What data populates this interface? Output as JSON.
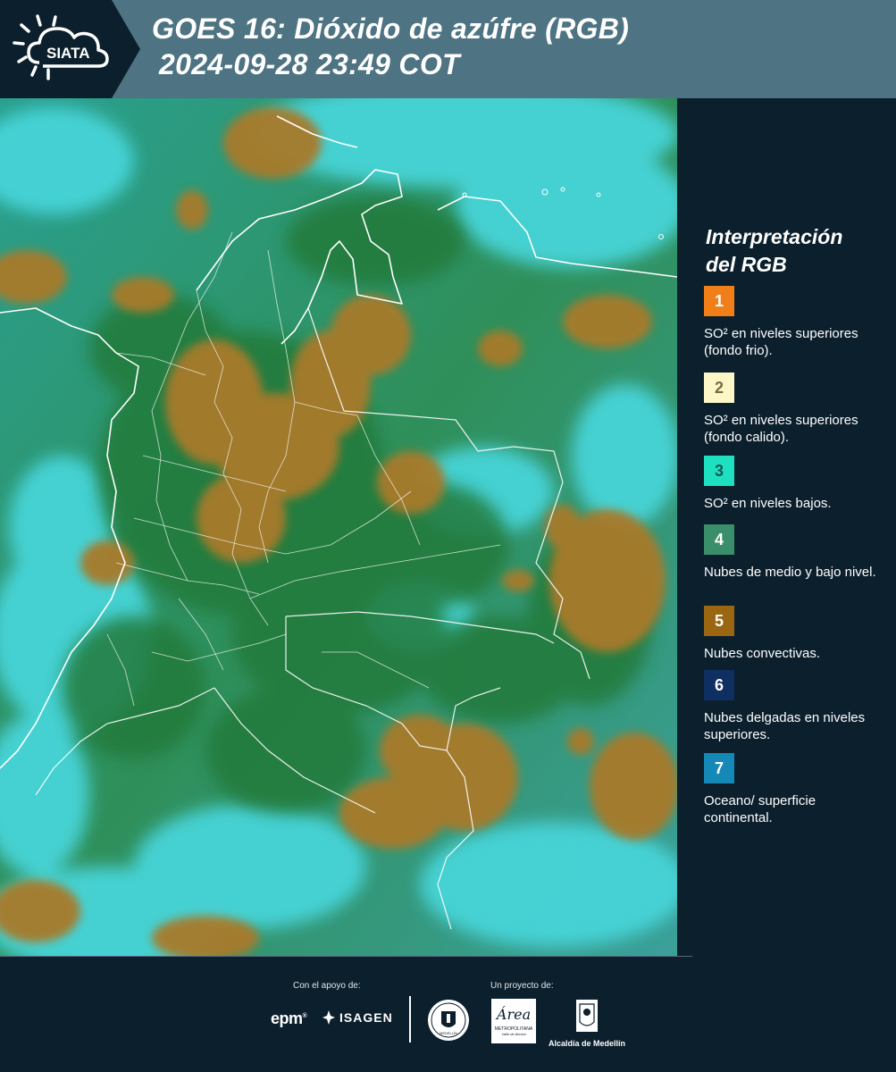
{
  "header": {
    "logo_text": "SIATA",
    "title": "GOES 16: Dióxido de azúfre (RGB)",
    "timestamp": "2024-09-28 23:49 COT"
  },
  "legend": {
    "title_line1": "Interpretación",
    "title_line2": "del RGB",
    "items": [
      {
        "num": "1",
        "color": "#f07f1a",
        "text_color": "#ffffff",
        "label": "SO² en niveles superiores (fondo frio)."
      },
      {
        "num": "2",
        "color": "#fdf7c8",
        "text_color": "#7a6a40",
        "label": "SO² en niveles superiores (fondo calido)."
      },
      {
        "num": "3",
        "color": "#1ee0c0",
        "text_color": "#0c5a55",
        "label": "SO² en niveles bajos."
      },
      {
        "num": "4",
        "color": "#3a8f6a",
        "text_color": "#ffffff",
        "label": "Nubes de medio y bajo nivel."
      },
      {
        "num": "5",
        "color": "#9a6612",
        "text_color": "#ffffff",
        "label": "Nubes convectivas."
      },
      {
        "num": "6",
        "color": "#0f2f63",
        "text_color": "#ffffff",
        "label": "Nubes delgadas en niveles superiores."
      },
      {
        "num": "7",
        "color": "#1489b8",
        "text_color": "#ffffff",
        "label": "Oceano/ superficie continental."
      }
    ]
  },
  "footer": {
    "support_label": "Con el apoyo de:",
    "project_label": "Un proyecto de:",
    "epm": "epm",
    "isagen": "ISAGEN",
    "metro_main": "Área",
    "metro_sub": "METROPOLITANA",
    "metro_sub2": "Valle de Aburrá",
    "alcaldia": "Alcaldía de Medellín",
    "medellin_seal": "MEDELLÍN"
  }
}
